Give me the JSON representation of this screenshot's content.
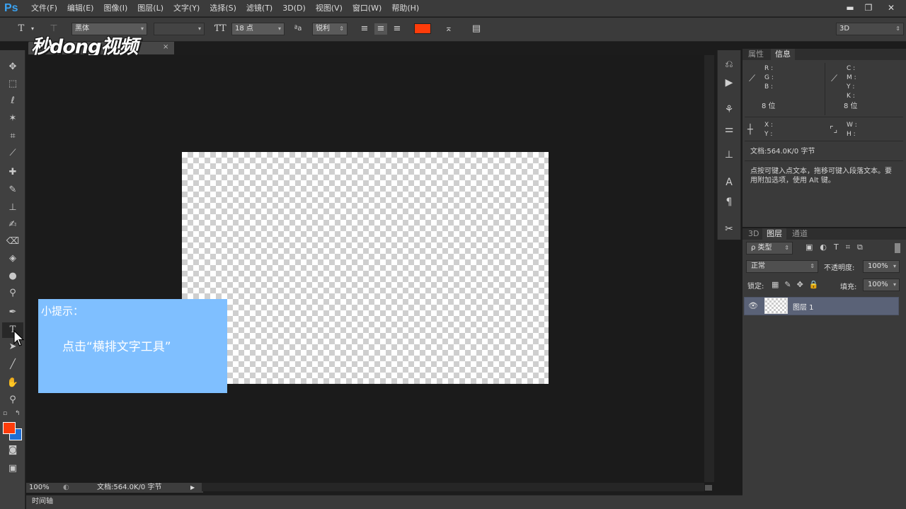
{
  "app": {
    "logo": "Ps"
  },
  "menu": [
    "文件(F)",
    "编辑(E)",
    "图像(I)",
    "图层(L)",
    "文字(Y)",
    "选择(S)",
    "滤镜(T)",
    "3D(D)",
    "视图(V)",
    "窗口(W)",
    "帮助(H)"
  ],
  "window_controls": {
    "minimize": "▬",
    "restore": "❐",
    "close": "✕"
  },
  "options": {
    "tool_glyph": "T",
    "font_family": "黑体",
    "font_size": "18 点",
    "antialias": "锐利",
    "workspace": "3D",
    "text_color": "#ff3c0a"
  },
  "watermark": "秒dong视频",
  "canvas": {
    "zoom": "100%",
    "doc_info": "文档:564.0K/0 字节",
    "timeline": "时间轴"
  },
  "tip": {
    "title": "小提示：",
    "body": "点击“横排文字工具”"
  },
  "panel_top": {
    "tabs": [
      "属性",
      "信息"
    ],
    "active_tab": "信息",
    "rgb_labels": [
      "R :",
      "G :",
      "B :"
    ],
    "cmyk_labels": [
      "C :",
      "M :",
      "Y :",
      "K :"
    ],
    "bit_left": "8 位",
    "bit_right": "8 位",
    "xy_labels": [
      "X :",
      "Y :"
    ],
    "wh_labels": [
      "W :",
      "H :"
    ],
    "doc_info": "文档:564.0K/0 字节",
    "hint": "点按可键入点文本，拖移可键入段落文本。要用附加选项，使用 Alt 键。"
  },
  "panel_bottom": {
    "tabs": [
      "3D",
      "图层",
      "通道"
    ],
    "active_tab": "图层",
    "filter_kind": "ρ 类型",
    "blend_mode": "正常",
    "opacity_label": "不透明度:",
    "opacity_value": "100%",
    "lock_label": "锁定:",
    "fill_label": "填充:",
    "fill_value": "100%",
    "layers": [
      {
        "name": "图层 1",
        "visible": true,
        "selected": true
      }
    ]
  },
  "colors": {
    "foreground": "#ff3c0a",
    "background": "#1f6ed4",
    "tip_bg": "#7fbfff"
  }
}
